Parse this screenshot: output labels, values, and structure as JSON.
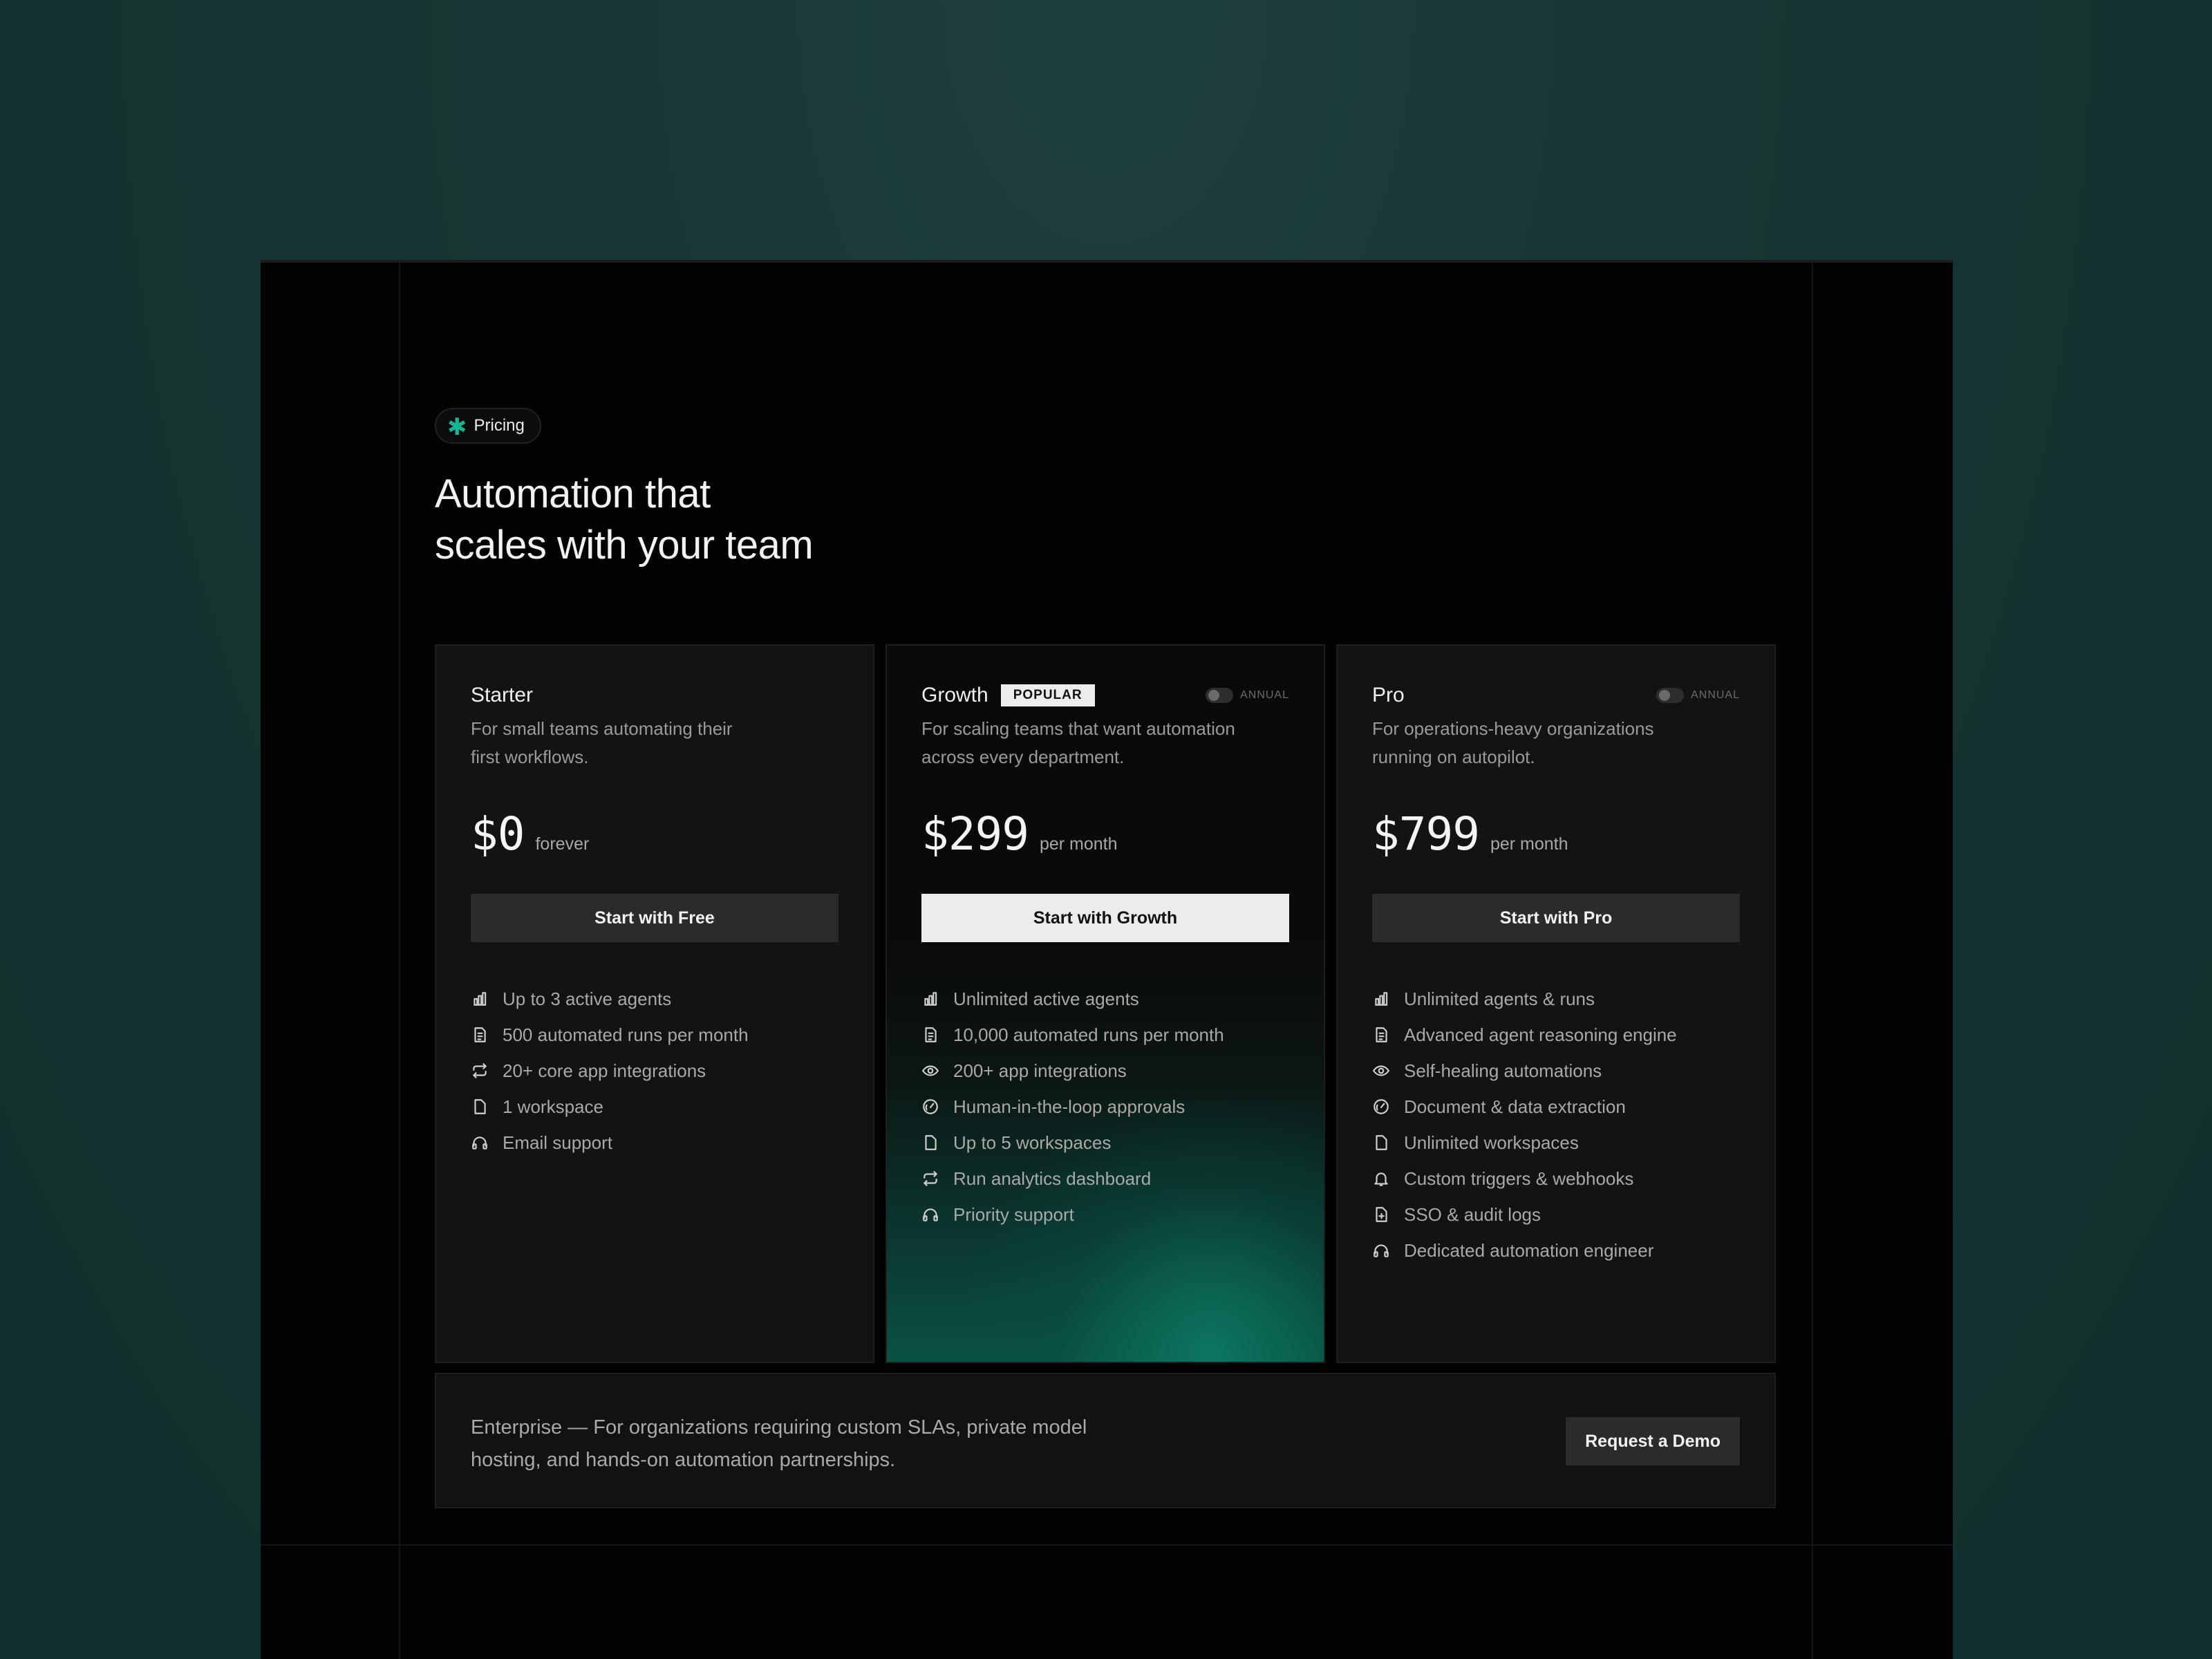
{
  "badge": {
    "icon": "asterisk-icon",
    "label": "Pricing"
  },
  "headline": {
    "line1": "Automation that",
    "line2": "scales with your team"
  },
  "plans": [
    {
      "name": "Starter",
      "description": "For small teams automating their first workflows.",
      "price": "$0",
      "period": "forever",
      "cta": "Start with Free",
      "features": [
        {
          "icon": "bar-chart-icon",
          "label": "Up to 3 active agents"
        },
        {
          "icon": "document-icon",
          "label": "500 automated runs per month"
        },
        {
          "icon": "repeat-icon",
          "label": "20+ core app integrations"
        },
        {
          "icon": "file-icon",
          "label": "1 workspace"
        },
        {
          "icon": "headphones-icon",
          "label": "Email support"
        }
      ]
    },
    {
      "name": "Growth",
      "tag": "POPULAR",
      "toggle_label": "ANNUAL",
      "description": "For scaling teams that want automation across every department.",
      "price": "$299",
      "period": "per month",
      "cta": "Start with Growth",
      "features": [
        {
          "icon": "bar-chart-icon",
          "label": "Unlimited active agents"
        },
        {
          "icon": "document-icon",
          "label": "10,000 automated runs per month"
        },
        {
          "icon": "eye-icon",
          "label": "200+ app integrations"
        },
        {
          "icon": "gauge-icon",
          "label": "Human-in-the-loop approvals"
        },
        {
          "icon": "file-icon",
          "label": "Up to 5 workspaces"
        },
        {
          "icon": "repeat-icon",
          "label": "Run analytics dashboard"
        },
        {
          "icon": "headphones-icon",
          "label": "Priority support"
        }
      ]
    },
    {
      "name": "Pro",
      "toggle_label": "ANNUAL",
      "description": "For operations-heavy organizations running on autopilot.",
      "price": "$799",
      "period": "per month",
      "cta": "Start with Pro",
      "features": [
        {
          "icon": "bar-chart-icon",
          "label": "Unlimited agents & runs"
        },
        {
          "icon": "document-icon",
          "label": "Advanced agent reasoning engine"
        },
        {
          "icon": "eye-icon",
          "label": "Self-healing automations"
        },
        {
          "icon": "gauge-icon",
          "label": "Document & data extraction"
        },
        {
          "icon": "file-icon",
          "label": "Unlimited workspaces"
        },
        {
          "icon": "bell-icon",
          "label": "Custom triggers & webhooks"
        },
        {
          "icon": "file-plus-icon",
          "label": "SSO & audit logs"
        },
        {
          "icon": "headphones-icon",
          "label": "Dedicated automation engineer"
        }
      ]
    }
  ],
  "enterprise": {
    "text": "Enterprise — For organizations requiring custom SLAs, private model hosting, and hands-on automation partnerships.",
    "cta": "Request a Demo"
  },
  "colors": {
    "background": "#163532",
    "frame": "#020202",
    "accent": "#19b493",
    "card": "#131313",
    "button_dark": "#2b2b2b",
    "button_light": "#ececec"
  }
}
